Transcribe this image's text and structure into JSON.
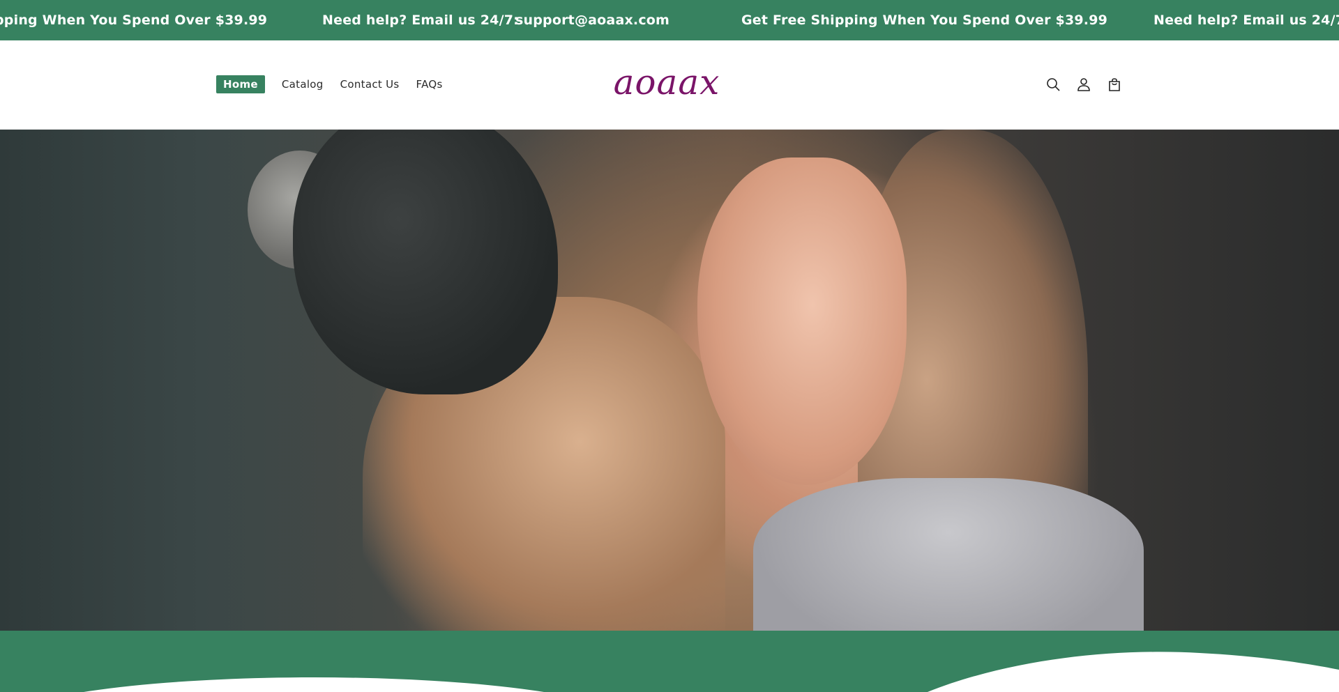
{
  "announcement": {
    "messages": [
      "pping When You Spend Over $39.99",
      "Need help? Email us 24/7:",
      "support@aoaax.com",
      "Get Free Shipping When You Spend Over $39.99",
      "Need help? Email us 24/7:"
    ]
  },
  "header": {
    "nav": [
      {
        "label": "Home",
        "active": true
      },
      {
        "label": "Catalog",
        "active": false
      },
      {
        "label": "Contact Us",
        "active": false
      },
      {
        "label": "FAQs",
        "active": false
      }
    ],
    "logo": "aoaax",
    "icons": [
      "search-icon",
      "account-icon",
      "cart-icon"
    ]
  },
  "colors": {
    "brand_green": "#378260",
    "logo_purple": "#7a1468",
    "nav_text": "#2b2b2b"
  }
}
